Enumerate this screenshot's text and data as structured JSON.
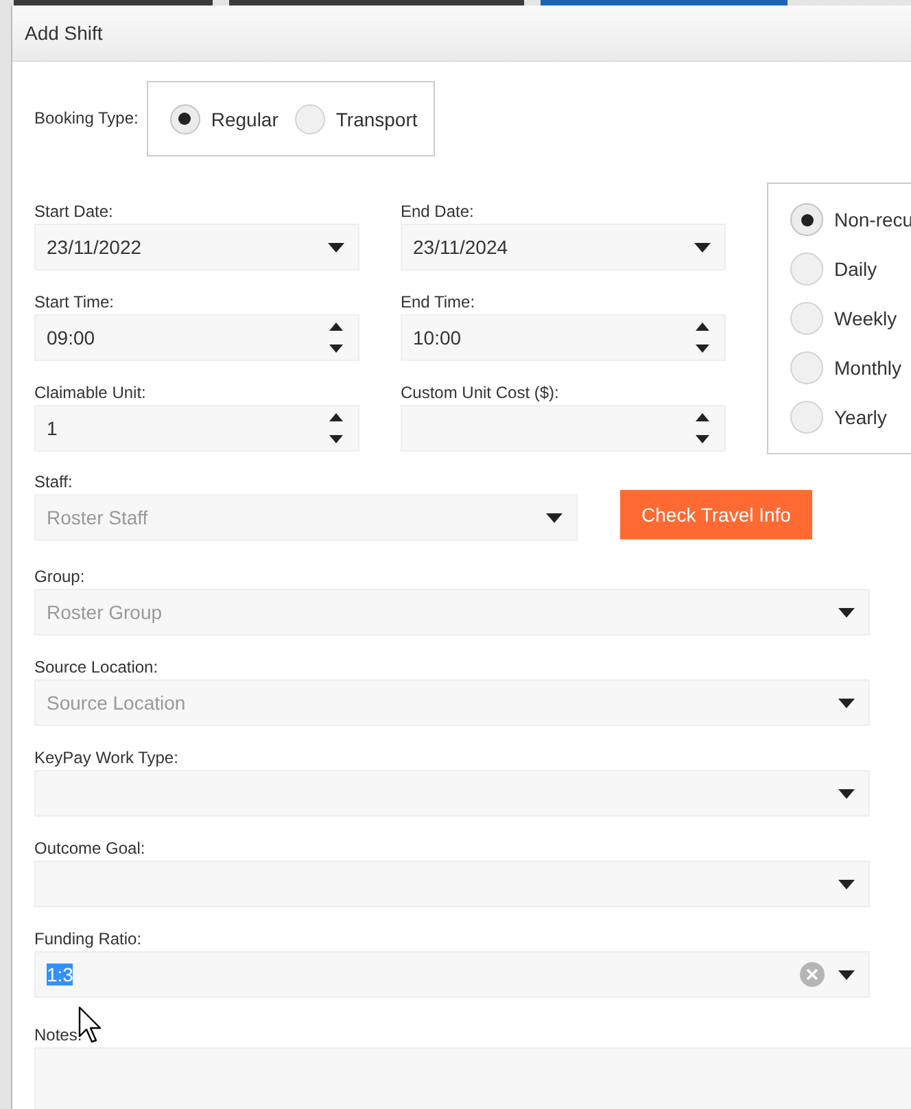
{
  "dialog": {
    "title": "Add Shift"
  },
  "booking_type": {
    "label": "Booking Type:",
    "options": [
      {
        "label": "Regular",
        "selected": true
      },
      {
        "label": "Transport",
        "selected": false
      }
    ]
  },
  "grid_fields": [
    {
      "label": "Start Date:",
      "kind": "date",
      "value": "23/11/2022"
    },
    {
      "label": "End Date:",
      "kind": "date",
      "value": "23/11/2024"
    },
    {
      "label": "Start Time:",
      "kind": "spinner",
      "value": "09:00"
    },
    {
      "label": "End Time:",
      "kind": "spinner",
      "value": "10:00"
    },
    {
      "label": "Claimable Unit:",
      "kind": "spinner",
      "value": "1"
    },
    {
      "label": "Custom Unit Cost ($):",
      "kind": "spinner"
    }
  ],
  "recurrence": [
    {
      "label": "Non-recu",
      "selected": true
    },
    {
      "label": "Daily",
      "selected": false
    },
    {
      "label": "Weekly",
      "selected": false
    },
    {
      "label": "Monthly",
      "selected": false
    },
    {
      "label": "Yearly",
      "selected": false
    }
  ],
  "staff": {
    "label": "Staff:",
    "placeholder": "Roster Staff"
  },
  "travel_button": "Check Travel Info",
  "wide_fields": [
    {
      "label": "Group:",
      "placeholder": "Roster Group"
    },
    {
      "label": "Source Location:",
      "placeholder": "Source Location"
    },
    {
      "label": "KeyPay Work Type:"
    },
    {
      "label": "Outcome Goal:"
    },
    {
      "label": "Funding Ratio:",
      "value": "1:3",
      "clearable": true,
      "highlighted": true
    }
  ],
  "notes": {
    "label": "Notes:"
  }
}
